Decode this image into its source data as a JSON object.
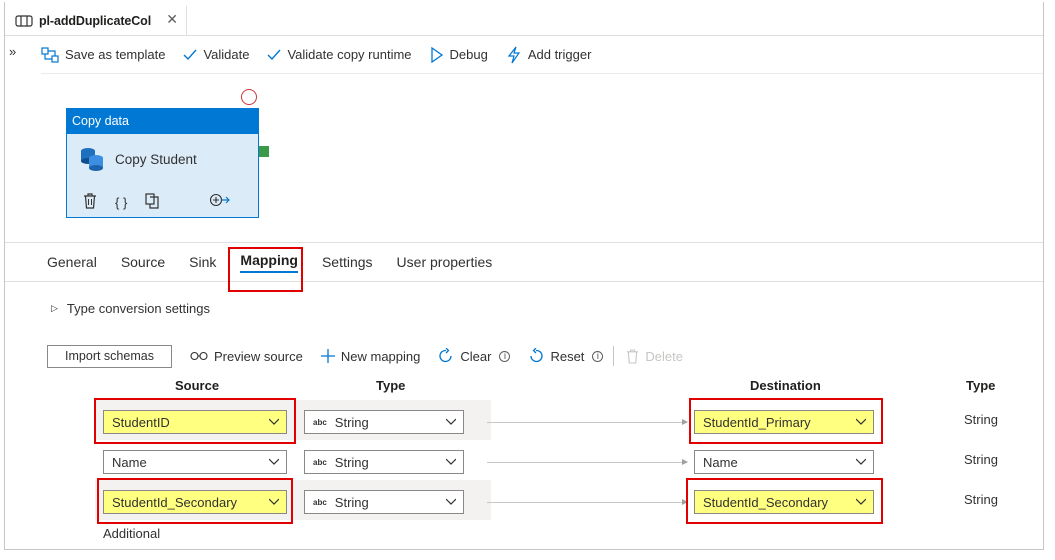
{
  "tab": {
    "title": "pl-addDuplicateCol",
    "close": "✕"
  },
  "toolbar": {
    "expand": "»",
    "save_template": "Save as template",
    "validate": "Validate",
    "validate_runtime": "Validate copy runtime",
    "debug": "Debug",
    "add_trigger": "Add trigger"
  },
  "activity": {
    "header": "Copy data",
    "name": "Copy Student",
    "actions": {
      "delete": "🗑",
      "code": "{ }",
      "copy": "⧉",
      "run_after": "⊕→"
    }
  },
  "props_tabs": [
    "General",
    "Source",
    "Sink",
    "Mapping",
    "Settings",
    "User properties"
  ],
  "active_tab": "Mapping",
  "type_conversion": {
    "caret": "▷",
    "label": "Type conversion settings"
  },
  "mapping_toolbar": {
    "import": "Import schemas",
    "preview": "Preview source",
    "new_mapping": "New mapping",
    "clear": "Clear",
    "reset": "Reset",
    "delete": "Delete",
    "info": "i"
  },
  "columns": {
    "source": "Source",
    "type": "Type",
    "destination": "Destination",
    "dest_type": "Type"
  },
  "rows": [
    {
      "source": "StudentID",
      "type": "String",
      "destination": "StudentId_Primary",
      "dest_type": "String",
      "highlight": true
    },
    {
      "source": "Name",
      "type": "String",
      "destination": "Name",
      "dest_type": "String",
      "highlight": false
    },
    {
      "source": "StudentId_Secondary",
      "type": "String",
      "destination": "StudentId_Secondary",
      "dest_type": "String",
      "highlight": true
    }
  ],
  "abc": "abc",
  "additional": "Additional",
  "colors": {
    "accent": "#0078d4",
    "highlight_border": "#e00000",
    "highlight_fill": "#ffff80",
    "activity_fill": "#dcebf8"
  }
}
